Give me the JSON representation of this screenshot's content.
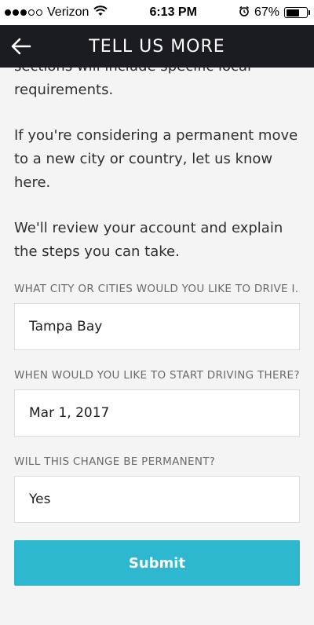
{
  "status_bar": {
    "carrier": "Verizon",
    "time": "6:13 PM",
    "battery_percent": "67%",
    "battery_level": 0.67,
    "signal_bars_filled": 3,
    "signal_bars_total": 5
  },
  "header": {
    "title": "TELL US MORE",
    "back_icon": "arrow-left-icon"
  },
  "content": {
    "paragraphs": [
      "sections will include specific local requirements.",
      "If you're considering a permanent move to a new city or country, let us know here.",
      "We'll review your account and explain the steps you can take."
    ]
  },
  "form": {
    "fields": [
      {
        "label": "WHAT CITY OR CITIES WOULD YOU LIKE TO DRIVE I...",
        "value": "Tampa Bay"
      },
      {
        "label": "WHEN WOULD YOU LIKE TO START DRIVING THERE?",
        "value": "Mar 1, 2017"
      },
      {
        "label": "WILL THIS CHANGE BE PERMANENT?",
        "value": "Yes"
      }
    ],
    "submit_label": "Submit"
  },
  "colors": {
    "header_bg": "#1b1b22",
    "accent": "#2eb8d0",
    "page_bg": "#f4f4f4"
  }
}
